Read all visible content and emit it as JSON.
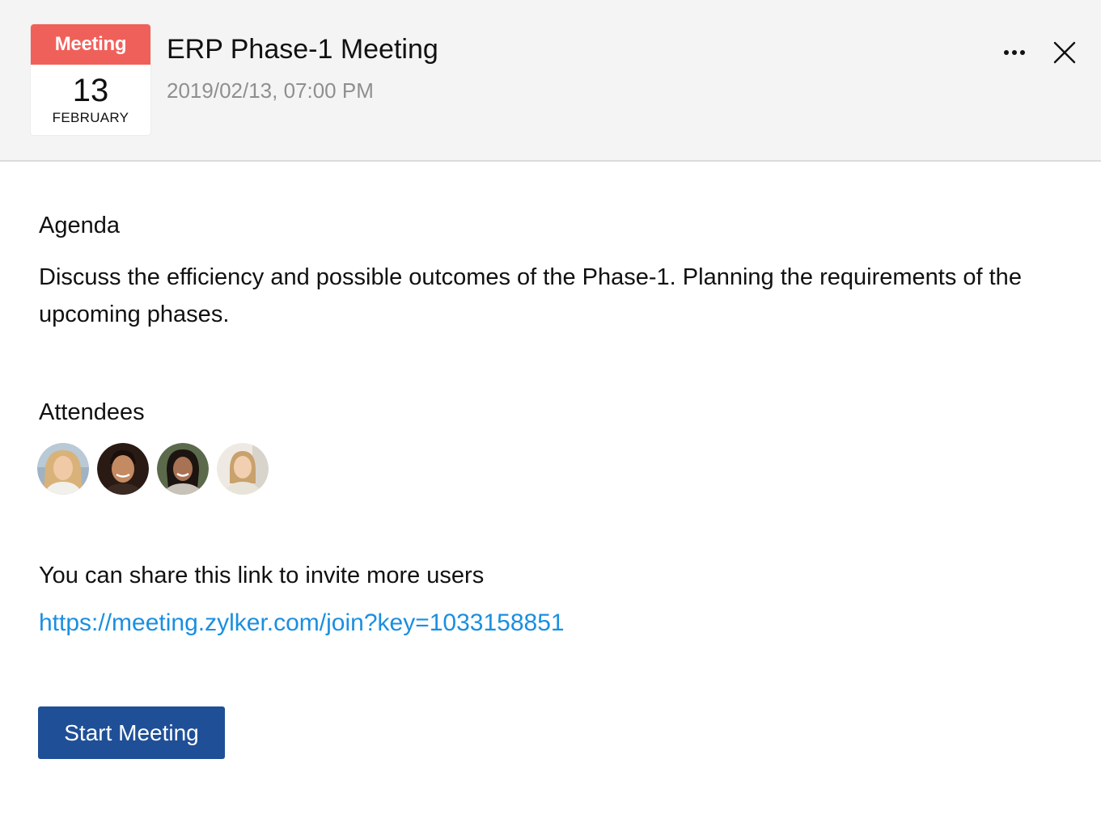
{
  "header": {
    "badge_label": "Meeting",
    "day": "13",
    "month": "FEBRUARY",
    "title": "ERP Phase-1 Meeting",
    "datetime": "2019/02/13, 07:00 PM",
    "more_icon": "more-horizontal-icon",
    "close_icon": "close-icon"
  },
  "agenda": {
    "heading": "Agenda",
    "text": "Discuss the efficiency and possible outcomes of the Phase-1. Planning the requirements of the upcoming phases."
  },
  "attendees": {
    "heading": "Attendees",
    "count": 4
  },
  "invite": {
    "heading": "You can share this link to invite more users",
    "link": "https://meeting.zylker.com/join?key=1033158851"
  },
  "actions": {
    "start_label": "Start Meeting"
  },
  "colors": {
    "badge": "#f0605a",
    "link": "#1a8fe0",
    "primary_button": "#1f4f96",
    "header_bg": "#f4f4f4",
    "muted_text": "#8f8f8f"
  }
}
